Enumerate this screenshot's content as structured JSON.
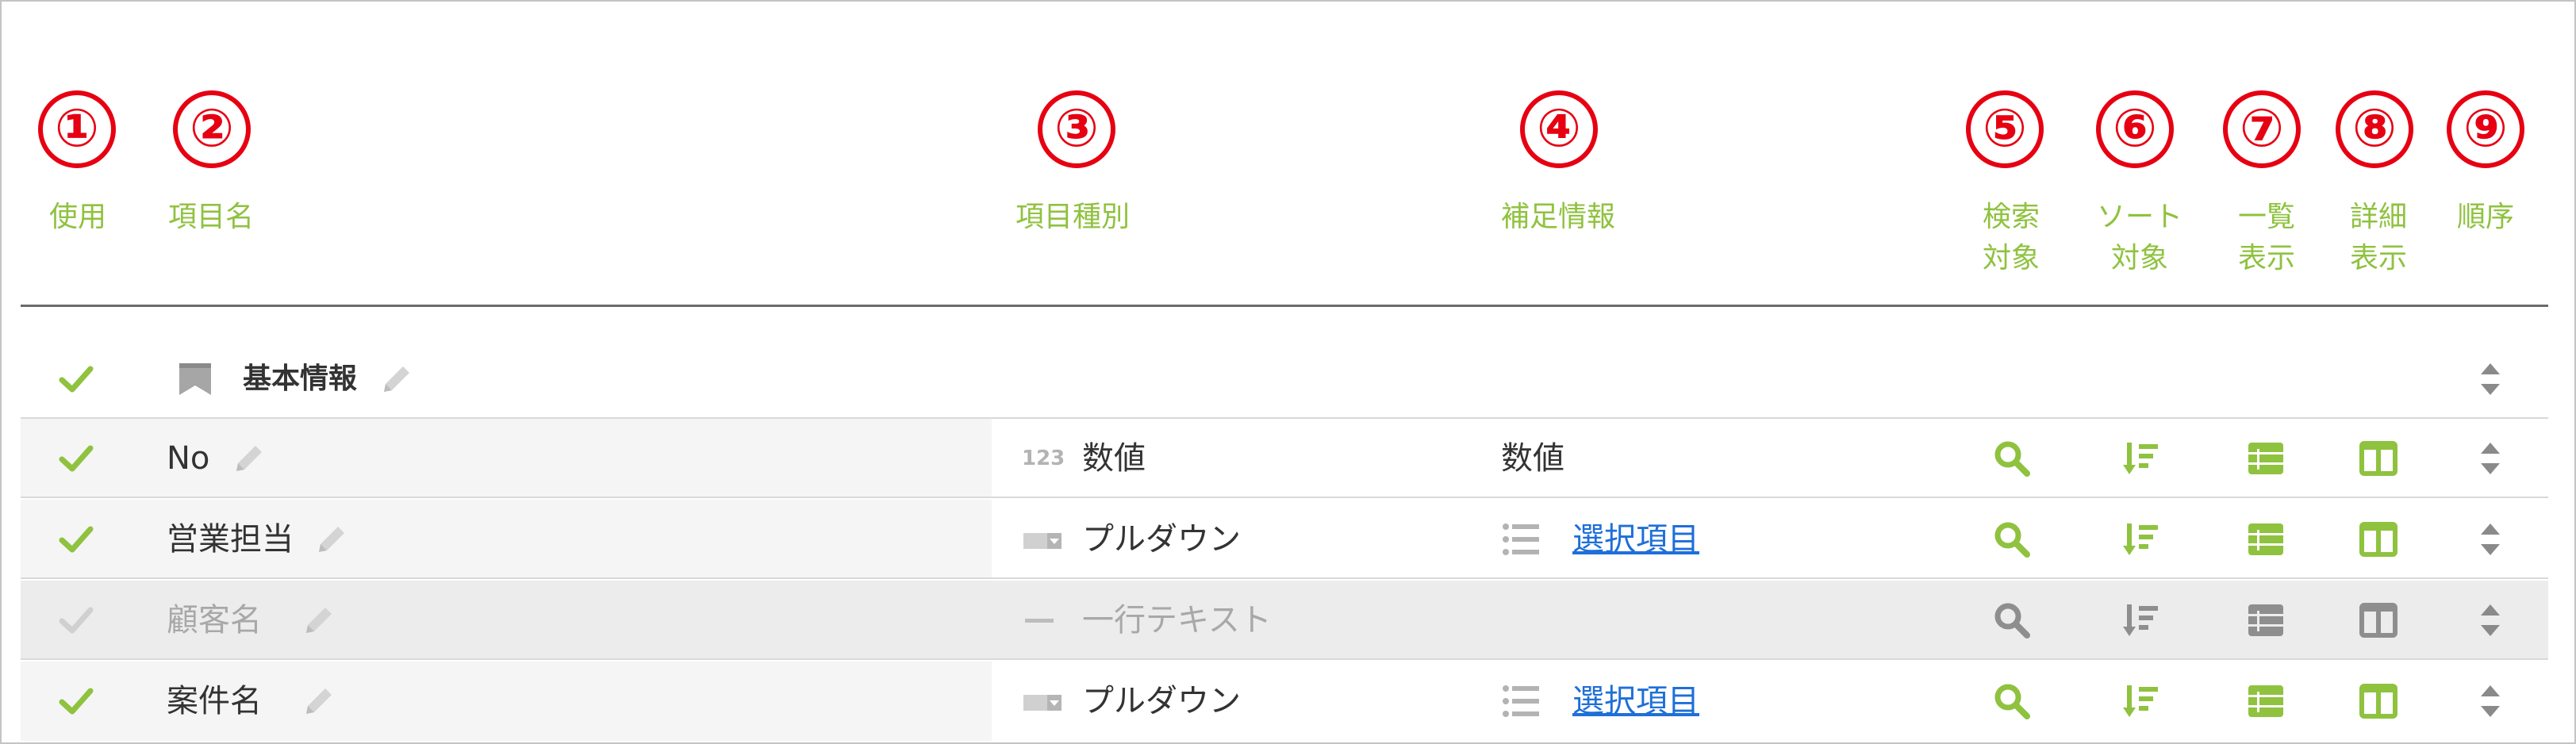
{
  "colors": {
    "accent": "#8fc23f",
    "badge": "#e60012",
    "disabled": "#a8a8a8",
    "link": "#1e6fd9"
  },
  "header": {
    "numbers": [
      "①",
      "②",
      "③",
      "④",
      "⑤",
      "⑥",
      "⑦",
      "⑧",
      "⑨"
    ],
    "use": "使用",
    "name": "項目名",
    "type": "項目種別",
    "info": "補足情報",
    "search_1": "検索",
    "search_2": "対象",
    "sort_1": "ソート",
    "sort_2": "対象",
    "list_1": "一覧",
    "list_2": "表示",
    "detail_1": "詳細",
    "detail_2": "表示",
    "order": "順序"
  },
  "section": {
    "label": "基本情報",
    "enabled": true,
    "icon": "bookmark-icon"
  },
  "fields": [
    {
      "name": "No",
      "enabled": true,
      "type_icon": "123",
      "type": "数値",
      "info": "数値",
      "info_is_link": false
    },
    {
      "name": "営業担当",
      "enabled": true,
      "type_icon": "dropdown-icon",
      "type": "プルダウン",
      "info": "選択項目",
      "info_is_link": true
    },
    {
      "name": "顧客名",
      "enabled": false,
      "type_icon": "dash-icon",
      "type": "一行テキスト",
      "info": "",
      "info_is_link": false
    },
    {
      "name": "案件名",
      "enabled": true,
      "type_icon": "dropdown-icon",
      "type": "プルダウン",
      "info": "選択項目",
      "info_is_link": true
    }
  ],
  "column_icons": [
    "search-icon",
    "sort-icon",
    "list-view-icon",
    "detail-view-icon",
    "reorder-icon"
  ]
}
